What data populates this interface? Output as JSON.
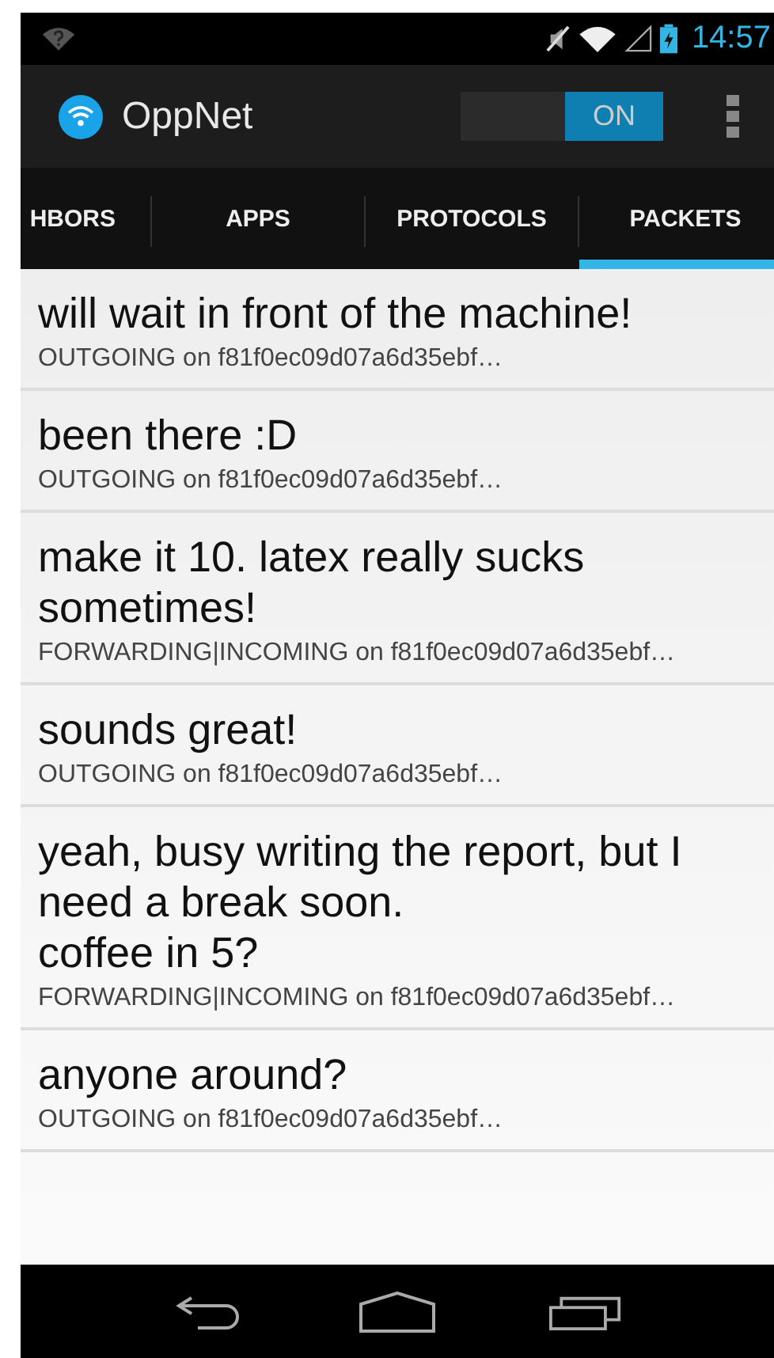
{
  "status_bar": {
    "time": "14:57"
  },
  "action_bar": {
    "title": "OppNet",
    "toggle": {
      "label": "ON",
      "on": true
    }
  },
  "tabs": [
    {
      "label": "HBORS",
      "selected": false
    },
    {
      "label": "APPS",
      "selected": false
    },
    {
      "label": "PROTOCOLS",
      "selected": false
    },
    {
      "label": "PACKETS",
      "selected": true
    }
  ],
  "packets": [
    {
      "message": "will wait in front of the machine!",
      "detail": "OUTGOING on f81f0ec09d07a6d35ebf…"
    },
    {
      "message": "been there :D",
      "detail": "OUTGOING on f81f0ec09d07a6d35ebf…"
    },
    {
      "message": "make it 10. latex really sucks sometimes!",
      "detail": "FORWARDING|INCOMING on f81f0ec09d07a6d35ebf…"
    },
    {
      "message": "sounds great!",
      "detail": "OUTGOING on f81f0ec09d07a6d35ebf…"
    },
    {
      "message": "yeah, busy writing the report, but I need a break soon.\ncoffee in 5?",
      "detail": "FORWARDING|INCOMING on f81f0ec09d07a6d35ebf…"
    },
    {
      "message": "anyone around?",
      "detail": "OUTGOING on f81f0ec09d07a6d35ebf…"
    }
  ]
}
